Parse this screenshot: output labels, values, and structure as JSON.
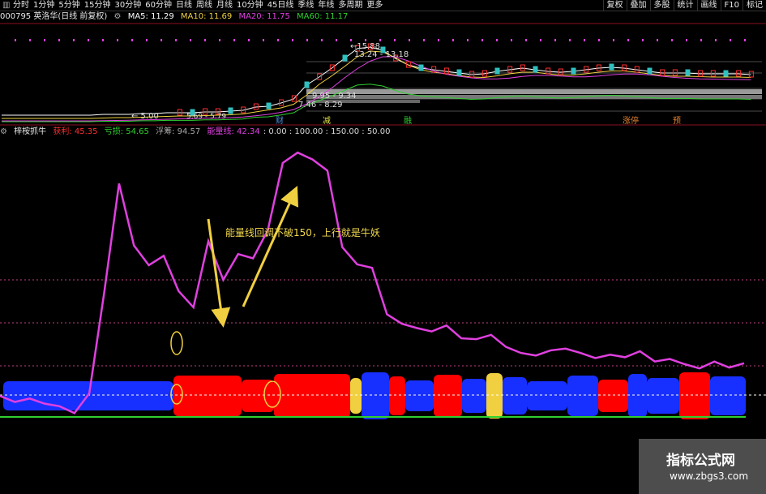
{
  "toolbar": {
    "timeframes": [
      "分时",
      "1分钟",
      "5分钟",
      "15分钟",
      "30分钟",
      "60分钟",
      "日线",
      "周线",
      "月线",
      "10分钟",
      "45日线",
      "季线",
      "年线",
      "多周期",
      "更多"
    ],
    "right_buttons": [
      "复权",
      "叠加",
      "多股",
      "统计",
      "画线",
      "F10",
      "标记"
    ]
  },
  "stock": {
    "code_title": "000795 英洛华(日线 前复权)"
  },
  "ma": {
    "ma5": "MA5: 11.29",
    "ma10": "MA10: 11.69",
    "ma20": "MA20: 11.75",
    "ma60": "MA60: 11.17",
    "ma5_color": "#ffffff",
    "ma10_color": "#f0d040",
    "ma20_color": "#e040e0",
    "ma60_color": "#30d030"
  },
  "price_panel": {
    "high_label": "15.88",
    "range_label": "13.24 - 13.18",
    "mid_label_1": "9.95 - 9.34",
    "mid_label_2": "7.46 - 8.29",
    "low_label": "5.00",
    "low_label_2": "5.69 - 5.79",
    "markers": [
      {
        "text": "财",
        "color": "#4a90e0"
      },
      {
        "text": "减",
        "color": "#e0e040"
      },
      {
        "text": "融",
        "color": "#30d030"
      },
      {
        "text": "涨停",
        "color": "#e08030"
      },
      {
        "text": "预",
        "color": "#e08030"
      }
    ]
  },
  "indicator": {
    "name": "梓桉抓牛",
    "profit": "获利: 45.35",
    "loss": "亏损: 54.65",
    "float": "浮筹: 94.57",
    "energy_label": "能量线: 42.34",
    "levels": ": 0.00 : 100.00 : 150.00 : 50.00",
    "profit_color": "#ff3030",
    "loss_color": "#30d030",
    "float_color": "#aaaaaa",
    "energy_color": "#e040e0"
  },
  "annotation": {
    "text": "能量线回调不破150，上行就是牛妖",
    "color": "#f2d84b"
  },
  "watermark": {
    "title": "指标公式网",
    "url": "www.zbgs3.com"
  },
  "chart_data": [
    {
      "type": "line",
      "title": "能量线",
      "series": [
        {
          "name": "能量线",
          "values": [
            15,
            8,
            12,
            6,
            3,
            -5,
            18,
            135,
            262,
            190,
            167,
            178,
            137,
            118,
            195,
            150,
            180,
            175,
            208,
            286,
            298,
            290,
            277,
            188,
            168,
            164,
            110,
            99,
            94,
            90,
            97,
            82,
            81,
            86,
            72,
            65,
            62,
            68,
            70,
            65,
            59,
            63,
            60,
            67,
            55,
            58,
            52,
            47,
            55,
            48,
            53
          ]
        }
      ],
      "levels": [
        0,
        100,
        150,
        50
      ]
    }
  ]
}
